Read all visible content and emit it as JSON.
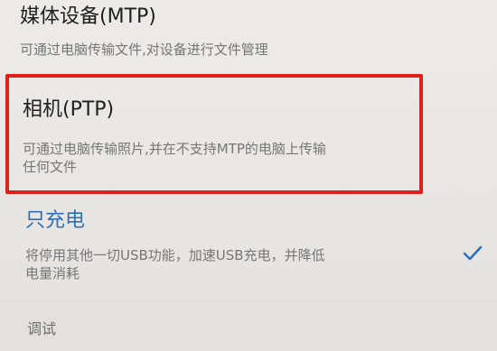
{
  "usb_options": {
    "mtp": {
      "title": "媒体设备(MTP)",
      "description": "可通过电脑传输文件,对设备进行文件管理"
    },
    "ptp": {
      "title": "相机(PTP)",
      "description_line1": "可通过电脑传输照片,并在不支持MTP的电脑上传输",
      "description_line2": "任何文件"
    },
    "charge_only": {
      "title": "只充电",
      "description_line1": "将停用其他一切USB功能，加速USB充电，并降低",
      "description_line2": "电量消耗",
      "selected": true,
      "check_icon": "checkmark-icon"
    }
  },
  "debug_section": {
    "label": "调试"
  },
  "colors": {
    "accent": "#2f6fb3",
    "highlight_border": "#e0201b"
  }
}
